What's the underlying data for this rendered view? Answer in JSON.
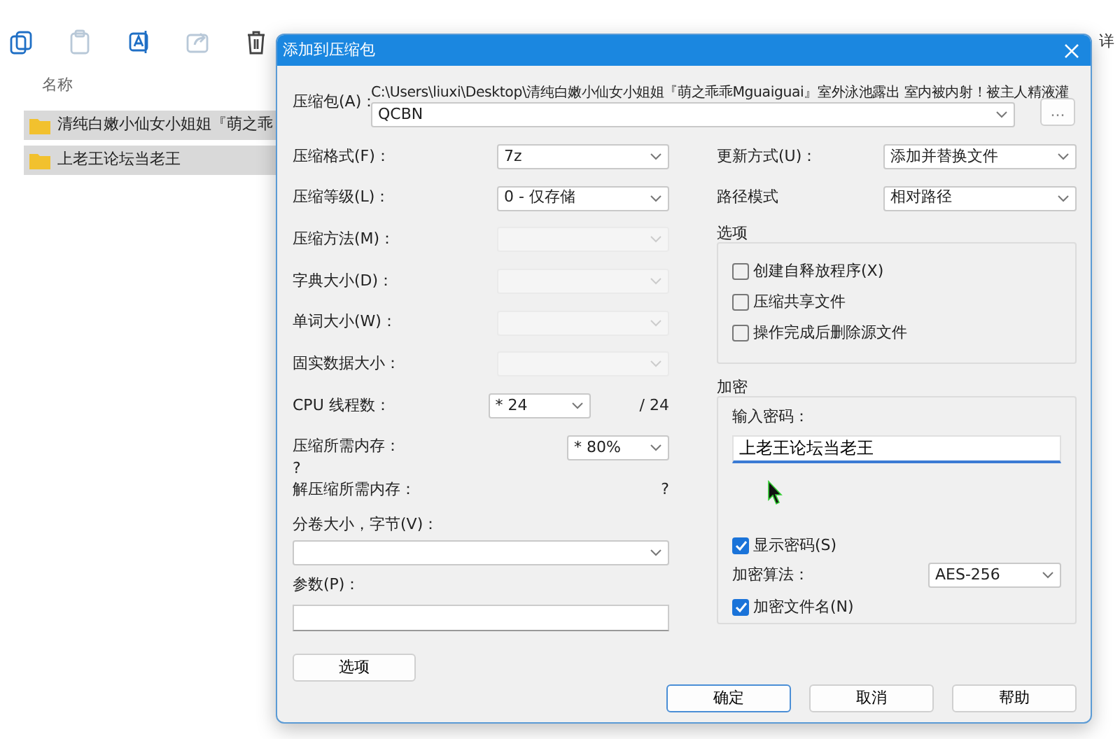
{
  "explorer": {
    "toolbar": [
      {
        "kind": "copy",
        "disabled": false
      },
      {
        "kind": "paste",
        "disabled": true
      },
      {
        "kind": "rename",
        "disabled": false
      },
      {
        "kind": "share",
        "disabled": true
      },
      {
        "kind": "delete",
        "disabled": false
      }
    ],
    "view_label": "详",
    "column_header": "名称",
    "files": [
      {
        "name": "清纯白嫩小仙女小姐姐『萌之乖",
        "selected": true
      },
      {
        "name": "上老王论坛当老王",
        "selected": true
      }
    ]
  },
  "dialog": {
    "title": "添加到压缩包",
    "archive": {
      "label": "压缩包(A)：",
      "path": "C:\\Users\\liuxi\\Desktop\\清纯白嫩小仙女小姐姐『萌之乖乖Mguaiguai』室外泳池露出 室内被内射！被主人精液灌",
      "value": "QCBN",
      "browse": "..."
    },
    "left_fields": [
      {
        "kind": "select",
        "label": "压缩格式(F)：",
        "value": "7z",
        "disabled": false
      },
      {
        "kind": "select",
        "label": "压缩等级(L)：",
        "value": "0 - 仅存储",
        "disabled": false
      },
      {
        "kind": "select",
        "label": "压缩方法(M)：",
        "disabled": true
      },
      {
        "kind": "select",
        "label": "字典大小(D)：",
        "disabled": true
      },
      {
        "kind": "select",
        "label": "单词大小(W)：",
        "disabled": true
      },
      {
        "kind": "select",
        "label": "固实数据大小：",
        "disabled": true
      },
      {
        "kind": "cpu",
        "label": "CPU 线程数：",
        "value": "* 24",
        "suffix": "/ 24"
      },
      {
        "kind": "memory",
        "label": "压缩所需内存：",
        "note": "?",
        "value": "* 80%"
      },
      {
        "kind": "info",
        "label": "解压缩所需内存：",
        "value": "?"
      },
      {
        "kind": "combo",
        "label": "分卷大小，字节(V)："
      },
      {
        "kind": "input",
        "label": "参数(P)："
      }
    ],
    "options_button": "选项",
    "right_fields": [
      {
        "label": "更新方式(U)：",
        "value": "添加并替换文件"
      },
      {
        "label": "路径模式",
        "value": "相对路径"
      }
    ],
    "options_group": {
      "title": "选项",
      "items": [
        {
          "label": "创建自释放程序(X)",
          "checked": false
        },
        {
          "label": "压缩共享文件",
          "checked": false
        },
        {
          "label": "操作完成后删除源文件",
          "checked": false
        }
      ]
    },
    "encryption": {
      "title": "加密",
      "password_label": "输入密码：",
      "password": "上老王论坛当老王",
      "show_password": {
        "label": "显示密码(S)",
        "checked": true
      },
      "algorithm_label": "加密算法：",
      "algorithm": "AES-256",
      "encrypt_names": {
        "label": "加密文件名(N)",
        "checked": true
      }
    },
    "buttons": [
      {
        "label": "确定",
        "default": true
      },
      {
        "label": "取消",
        "default": false
      },
      {
        "label": "帮助",
        "default": false
      }
    ]
  }
}
